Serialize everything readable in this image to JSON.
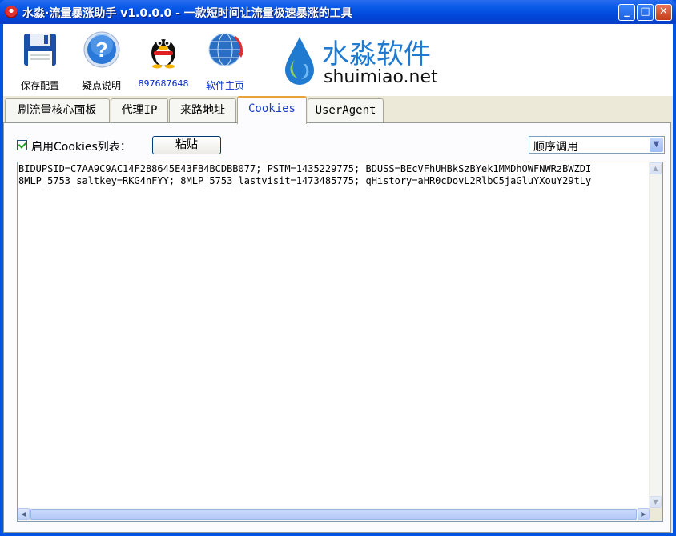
{
  "window": {
    "title": "水淼·流量暴涨助手 v1.0.0.0 - 一款短时间让流量极速暴涨的工具",
    "buttons": {
      "minimize": "_",
      "maximize": "□",
      "close": "✕"
    }
  },
  "toolbar": {
    "items": [
      {
        "label": "保存配置",
        "icon": "floppy-disk-icon"
      },
      {
        "label": "疑点说明",
        "icon": "help-question-icon"
      },
      {
        "label": "897687648",
        "icon": "qq-penguin-icon"
      },
      {
        "label": "软件主页",
        "icon": "globe-icon"
      }
    ],
    "logo": {
      "name": "水淼软件",
      "domain": "shuimiao.net"
    }
  },
  "tabs": [
    {
      "label": "刷流量核心面板",
      "active": false
    },
    {
      "label": "代理IP",
      "active": false
    },
    {
      "label": "来路地址",
      "active": false
    },
    {
      "label": "Cookies",
      "active": true
    },
    {
      "label": "UserAgent",
      "active": false
    }
  ],
  "cookies_panel": {
    "enable_label": "启用Cookies列表：",
    "enabled": true,
    "paste_button": "粘贴",
    "order_select": {
      "selected": "顺序调用"
    },
    "lines": [
      "BIDUPSID=C7AA9C9AC14F288645E43FB4BCDBB077; PSTM=1435229775; BDUSS=BEcVFhUHBkSzBYek1MMDhOWFNWRzBWZDI",
      "8MLP_5753_saltkey=RKG4nFYY; 8MLP_5753_lastvisit=1473485775; qHistory=aHR0cDovL2RlbC5jaGluYXouY29tLy"
    ]
  },
  "colors": {
    "title_bar": "#0054e3",
    "tab_active_accent": "#e8a23a",
    "link_blue": "#0a2ec8",
    "logo_blue": "#1f7ad0"
  }
}
